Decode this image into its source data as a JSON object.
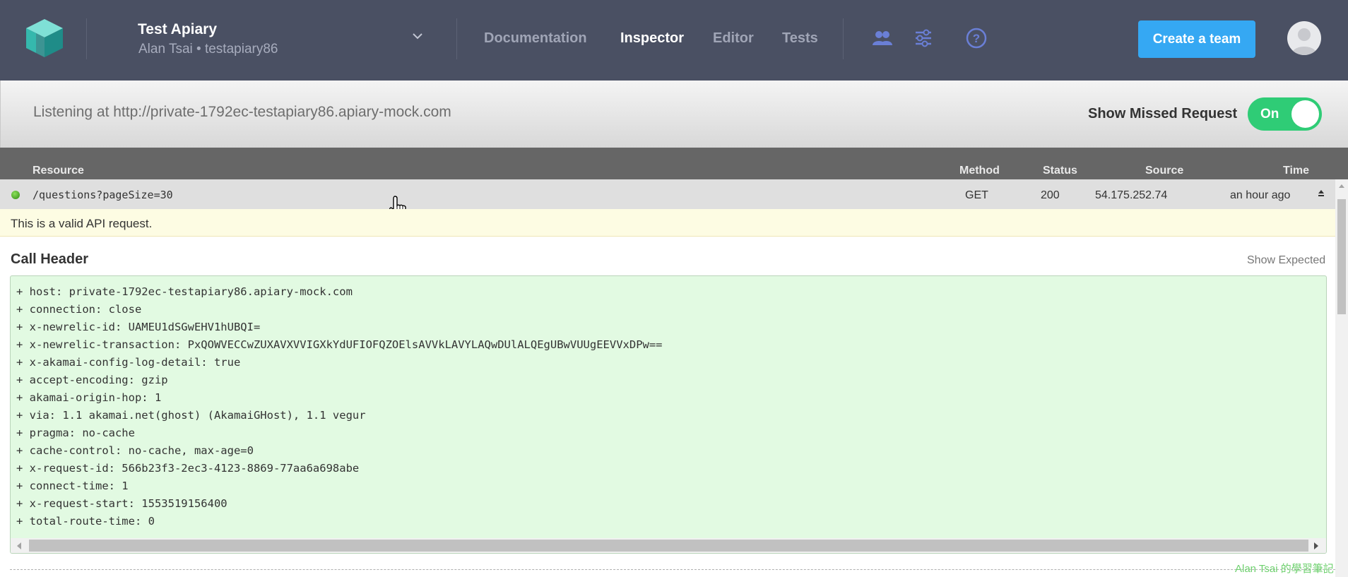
{
  "colors": {
    "topbar": "#4a5063",
    "accent_button": "#35a8f3",
    "toggle_on": "#2fcc76",
    "table_header": "#666666",
    "code_bg": "#e2fae2",
    "valid_banner": "#fdfce3",
    "nav_icon": "#6a7fd6"
  },
  "header": {
    "project_title": "Test Apiary",
    "project_subtitle": "Alan Tsai • testapiary86",
    "nav": [
      {
        "label": "Documentation"
      },
      {
        "label": "Inspector",
        "active": true
      },
      {
        "label": "Editor"
      },
      {
        "label": "Tests"
      }
    ],
    "icons": [
      "team-icon",
      "settings-sliders-icon",
      "help-icon"
    ],
    "create_team_label": "Create a team"
  },
  "listening": {
    "text": "Listening at http://private-1792ec-testapiary86.apiary-mock.com",
    "show_missed_label": "Show Missed Request",
    "toggle_label": "On",
    "toggle_on": true
  },
  "table": {
    "columns": [
      "Resource",
      "Method",
      "Status",
      "Source",
      "Time"
    ],
    "rows": [
      {
        "resource": "/questions?pageSize=30",
        "method": "GET",
        "status": "200",
        "source": "54.175.252.74",
        "time": "an hour ago"
      }
    ]
  },
  "validation": {
    "message": "This is a valid API request."
  },
  "call_header": {
    "title": "Call Header",
    "show_expected_label": "Show Expected",
    "lines": [
      "+ host: private-1792ec-testapiary86.apiary-mock.com",
      "+ connection: close",
      "+ x-newrelic-id: UAMEU1dSGwEHV1hUBQI=",
      "+ x-newrelic-transaction: PxQOWVECCwZUXAVXVVIGXkYdUFIOFQZOElsAVVkLAVYLAQwDUlALQEgUBwVUUgEEVVxDPw==",
      "+ x-akamai-config-log-detail: true",
      "+ accept-encoding: gzip",
      "+ akamai-origin-hop: 1",
      "+ via: 1.1 akamai.net(ghost) (AkamaiGHost), 1.1 vegur",
      "+ pragma: no-cache",
      "+ cache-control: no-cache, max-age=0",
      "+ x-request-id: 566b23f3-2ec3-4123-8869-77aa6a698abe",
      "+ connect-time: 1",
      "+ x-request-start: 1553519156400",
      "+ total-route-time: 0"
    ]
  },
  "watermark": "Alan Tsai 的學習筆記"
}
